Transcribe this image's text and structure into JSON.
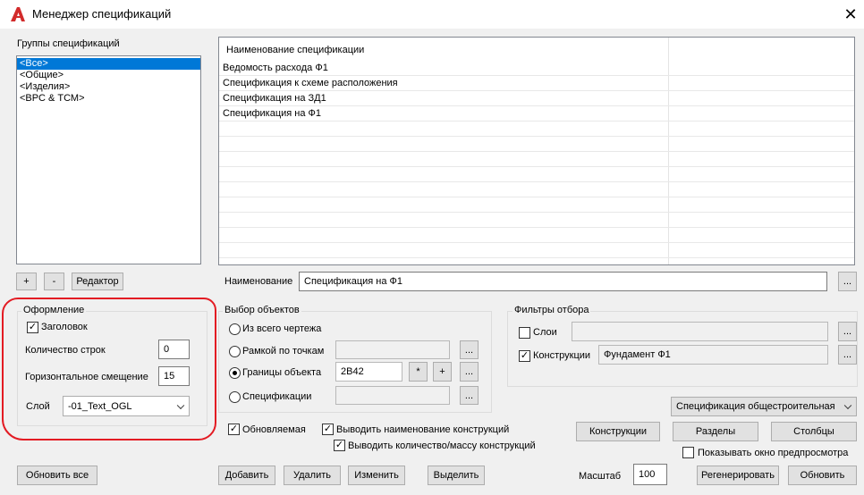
{
  "window": {
    "title": "Менеджер спецификаций",
    "app_icon": "autocad-a-icon",
    "close_glyph": "✕"
  },
  "groups": {
    "label": "Группы спецификаций",
    "items": [
      "<Все>",
      "<Общие>",
      "<Изделия>",
      "<ВРС & ТСМ>"
    ],
    "selected_index": 0,
    "add_label": "+",
    "remove_label": "-",
    "editor_label": "Редактор"
  },
  "spec_table": {
    "header": "Наименование спецификации",
    "rows": [
      "Ведомость расхода Ф1",
      "Спецификация к схеме расположения",
      "Спецификация на ЗД1",
      "Спецификация на Ф1"
    ]
  },
  "name_field": {
    "label": "Наименование",
    "value": "Спецификация на Ф1",
    "browse_label": "..."
  },
  "appearance": {
    "title": "Оформление",
    "header_checkbox_label": "Заголовок",
    "header_checked": true,
    "rows_label": "Количество строк",
    "rows_value": "0",
    "hoffset_label": "Горизонтальное смещение",
    "hoffset_value": "15",
    "layer_label": "Слой",
    "layer_value": "-01_Text_OGL",
    "highlight_color": "#e31b23"
  },
  "selection": {
    "title": "Выбор объектов",
    "options": [
      "Из всего чертежа",
      "Рамкой по точкам",
      "Границы объекта",
      "Спецификации"
    ],
    "selected_index": 2,
    "bounds_value": "2В42",
    "star_label": "*",
    "plus_label": "+",
    "browse_label": "..."
  },
  "filters": {
    "title": "Фильтры отбора",
    "layers_label": "Слои",
    "layers_checked": false,
    "layers_value": "",
    "constructions_label": "Конструкции",
    "constructions_checked": true,
    "constructions_value": "Фундамент Ф1",
    "browse_label": "..."
  },
  "spec_type": {
    "value": "Спецификация общестроительная"
  },
  "options": {
    "updatable_label": "Обновляемая",
    "updatable_checked": true,
    "show_name_label": "Выводить наименование конструкций",
    "show_name_checked": true,
    "show_qty_label": "Выводить количество/массу конструкций",
    "show_qty_checked": true,
    "preview_label": "Показывать окно предпросмотра",
    "preview_checked": false
  },
  "buttons": {
    "constructions": "Конструкции",
    "sections": "Разделы",
    "columns": "Столбцы",
    "update_all": "Обновить все",
    "add": "Добавить",
    "delete": "Удалить",
    "modify": "Изменить",
    "select": "Выделить",
    "regenerate": "Регенерировать",
    "update": "Обновить"
  },
  "scale": {
    "label": "Масштаб",
    "value": "100"
  },
  "check_glyph": "✓"
}
